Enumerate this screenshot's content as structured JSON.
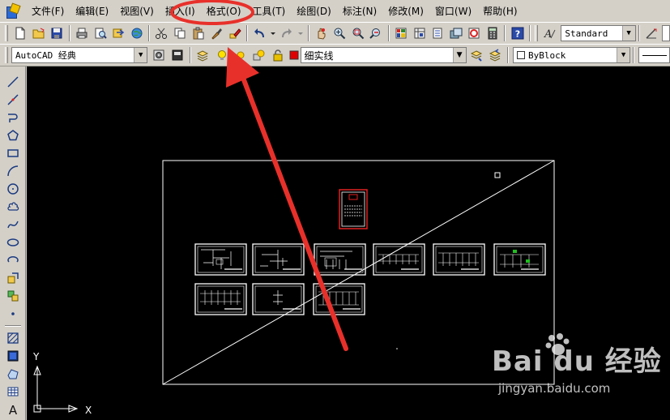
{
  "menubar": {
    "items": [
      "文件(F)",
      "编辑(E)",
      "视图(V)",
      "插入(I)",
      "格式(O)",
      "工具(T)",
      "绘图(D)",
      "标注(N)",
      "修改(M)",
      "窗口(W)",
      "帮助(H)"
    ],
    "highlighted_item": "格式(O)"
  },
  "toolbar1": {
    "text_style_value": "Standard"
  },
  "toolbar2": {
    "workspace_value": "AutoCAD 经典",
    "linetype_value": "细实线",
    "color_value": "ByBlock"
  },
  "canvas": {
    "ucs_x_label": "X",
    "ucs_y_label": "Y",
    "background": "#000000"
  },
  "watermark": {
    "logo_text": "Bai  du 经验",
    "url_text": "jingyan.baidu.com"
  },
  "annotation": {
    "color": "#e8302a"
  }
}
